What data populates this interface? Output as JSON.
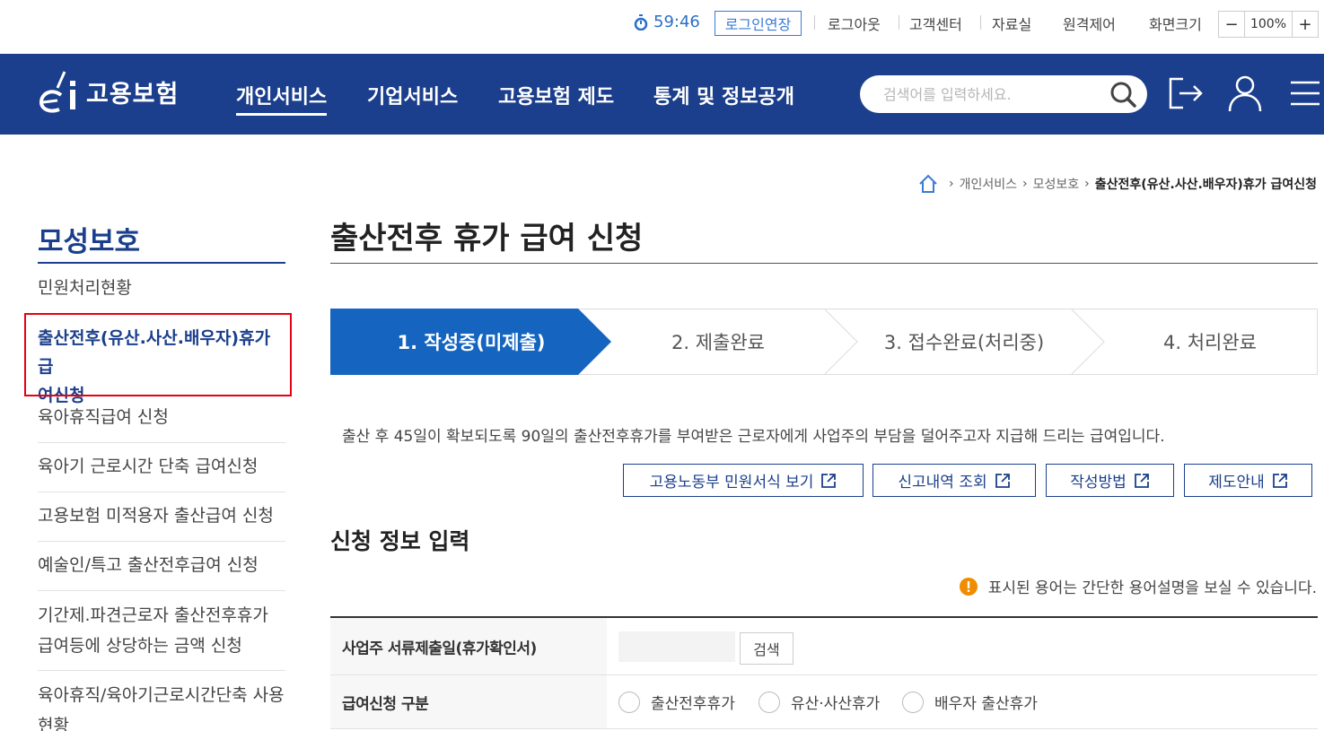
{
  "util": {
    "timer": "59:46",
    "extend_label": "로그인연장",
    "links": [
      "로그아웃",
      "고객센터",
      "자료실",
      "원격제어",
      "화면크기"
    ],
    "zoom_minus": "−",
    "zoom_value": "100%",
    "zoom_plus": "+"
  },
  "header": {
    "logo_text": "고용보험",
    "nav": [
      "개인서비스",
      "기업서비스",
      "고용보험 제도",
      "통계 및 정보공개"
    ],
    "active_nav": "개인서비스",
    "search_placeholder": "검색어를 입력하세요."
  },
  "breadcrumb": {
    "items": [
      "개인서비스",
      "모성보호"
    ],
    "current": "출산전후(유산.사산.배우자)휴가 급여신청"
  },
  "sidebar": {
    "title": "모성보호",
    "items": [
      "민원처리현황",
      "출산전후(유산.사산.배우자)휴가 급",
      "여신청",
      "육아휴직급여 신청",
      "육아기 근로시간 단축 급여신청",
      "고용보험 미적용자 출산급여 신청",
      "예술인/특고 출산전후급여 신청",
      "기간제.파견근로자 출산전후휴가",
      "급여등에 상당하는 금액 신청",
      "육아휴직/육아기근로시간단축 사용",
      "현황"
    ]
  },
  "main": {
    "title": "출산전후 휴가 급여 신청",
    "steps": [
      "1. 작성중(미제출)",
      "2. 제출완료",
      "3. 접수완료(처리중)",
      "4. 처리완료"
    ],
    "description": "출산 후 45일이 확보되도록 90일의 출산전후휴가를 부여받은 근로자에게 사업주의 부담을 덜어주고자 지급해 드리는 급여입니다.",
    "buttons": [
      "고용노동부 민원서식 보기",
      "신고내역 조회",
      "작성방법",
      "제도안내"
    ],
    "section_title": "신청 정보 입력",
    "notice": "표시된 용어는 간단한 용어설명을 보실 수 있습니다.",
    "form": {
      "row1_label": "사업주 서류제출일(휴가확인서)",
      "row1_button": "검색",
      "row2_label": "급여신청 구분",
      "radios": [
        "출산전후휴가",
        "유산·사산휴가",
        "배우자 출산휴가"
      ]
    }
  },
  "colors": {
    "navy": "#1b3f8c",
    "step_active": "#1565c0",
    "highlight": "#e60012",
    "notice_orange": "#f08c00"
  }
}
